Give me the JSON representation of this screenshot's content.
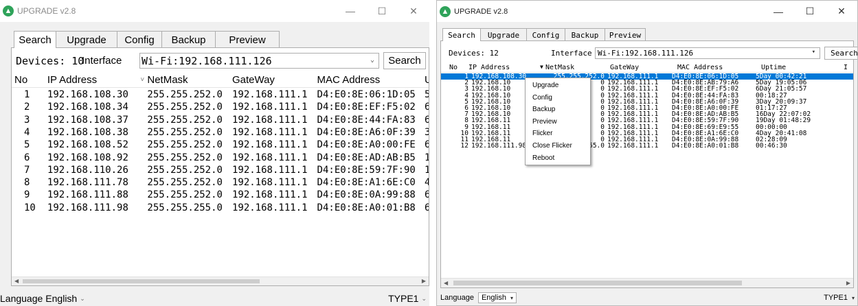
{
  "left": {
    "title": "UPGRADE v2.8",
    "tabs": [
      {
        "label": "Search"
      },
      {
        "label": "Upgrade"
      },
      {
        "label": "Config"
      },
      {
        "label": "Backup"
      },
      {
        "label": "Preview"
      }
    ],
    "devices_label": "Devices: 10",
    "interface_label": "Interface",
    "interface_value": "Wi-Fi:192.168.111.126",
    "search_button": "Search",
    "headers": [
      "No",
      "IP Address",
      "NetMask",
      "GateWay",
      "MAC Address",
      "U"
    ],
    "rows": [
      [
        "1",
        "192.168.108.30",
        "255.255.252.0",
        "192.168.111.1",
        "D4:E0:8E:06:1D:05",
        "5"
      ],
      [
        "2",
        "192.168.108.34",
        "255.255.252.0",
        "192.168.111.1",
        "D4:E0:8E:EF:F5:02",
        "6"
      ],
      [
        "3",
        "192.168.108.37",
        "255.255.252.0",
        "192.168.111.1",
        "D4:E0:8E:44:FA:83",
        "6"
      ],
      [
        "4",
        "192.168.108.38",
        "255.255.252.0",
        "192.168.111.1",
        "D4:E0:8E:A6:0F:39",
        "3"
      ],
      [
        "5",
        "192.168.108.52",
        "255.255.252.0",
        "192.168.111.1",
        "D4:E0:8E:A0:00:FE",
        "6"
      ],
      [
        "6",
        "192.168.108.92",
        "255.255.252.0",
        "192.168.111.1",
        "D4:E0:8E:AD:AB:B5",
        "1"
      ],
      [
        "7",
        "192.168.110.26",
        "255.255.252.0",
        "192.168.111.1",
        "D4:E0:8E:59:7F:90",
        "1"
      ],
      [
        "8",
        "192.168.111.78",
        "255.255.252.0",
        "192.168.111.1",
        "D4:E0:8E:A1:6E:C0",
        "4"
      ],
      [
        "9",
        "192.168.111.88",
        "255.255.252.0",
        "192.168.111.1",
        "D4:E0:8E:0A:99:88",
        "6"
      ],
      [
        "10",
        "192.168.111.98",
        "255.255.255.0",
        "192.168.111.1",
        "D4:E0:8E:A0:01:B8",
        "6"
      ]
    ],
    "language_label": "Language",
    "language_value": "English",
    "type_value": "TYPE1"
  },
  "right": {
    "title": "UPGRADE v2.8",
    "tabs": [
      {
        "label": "Search"
      },
      {
        "label": "Upgrade"
      },
      {
        "label": "Config"
      },
      {
        "label": "Backup"
      },
      {
        "label": "Preview"
      }
    ],
    "devices_label": "Devices: 12",
    "interface_label": "Interface",
    "interface_value": "Wi-Fi:192.168.111.126",
    "search_button": "Search",
    "headers": [
      "No",
      "IP Address",
      "NetMask",
      "GateWay",
      "MAC Address",
      "Uptime",
      "I"
    ],
    "rows": [
      [
        "1",
        "192.168.108.30",
        "255.255.252.0",
        "192.168.111.1",
        "D4:E0:8E:06:1D:05",
        "5Day 00:42:21"
      ],
      [
        "2",
        "192.168.10",
        "0",
        "192.168.111.1",
        "D4:E0:8E:AB:79:A6",
        "5Day 19:05:06"
      ],
      [
        "3",
        "192.168.10",
        "0",
        "192.168.111.1",
        "D4:E0:8E:EF:F5:02",
        "6Day 21:05:57"
      ],
      [
        "4",
        "192.168.10",
        "0",
        "192.168.111.1",
        "D4:E0:8E:44:FA:83",
        "00:18:27"
      ],
      [
        "5",
        "192.168.10",
        "0",
        "192.168.111.1",
        "D4:E0:8E:A6:0F:39",
        "3Day 20:09:37"
      ],
      [
        "6",
        "192.168.10",
        "0",
        "192.168.111.1",
        "D4:E0:8E:A0:00:FE",
        "01:17:27"
      ],
      [
        "7",
        "192.168.10",
        "0",
        "192.168.111.1",
        "D4:E0:8E:AD:AB:B5",
        "16Day 22:07:02"
      ],
      [
        "8",
        "192.168.11",
        "0",
        "192.168.111.1",
        "D4:E0:8E:59:7F:90",
        "19Day 01:48:29"
      ],
      [
        "9",
        "192.168.11",
        "0",
        "192.168.111.1",
        "D4:E0:8E:69:E9:55",
        "00:00:00"
      ],
      [
        "10",
        "192.168.11",
        "0",
        "192.168.111.1",
        "D4:E0:8E:A1:6E:C0",
        "4Day 20:41:08"
      ],
      [
        "11",
        "192.168.11",
        "0",
        "192.168.111.1",
        "D4:E0:8E:0A:99:88",
        "02:28:09"
      ],
      [
        "12",
        "192.168.111.98",
        "255.255.255.0",
        "192.168.111.1",
        "D4:E0:8E:A0:01:B8",
        "00:46:30"
      ]
    ],
    "context_menu": [
      "Upgrade",
      "Config",
      "Backup",
      "Preview",
      "Flicker",
      "Close Flicker",
      "Reboot"
    ],
    "language_label": "Language",
    "language_value": "English",
    "type_value": "TYPE1"
  },
  "colors": {
    "selection": "#0078d7",
    "accent_icon": "#2fa35a"
  }
}
